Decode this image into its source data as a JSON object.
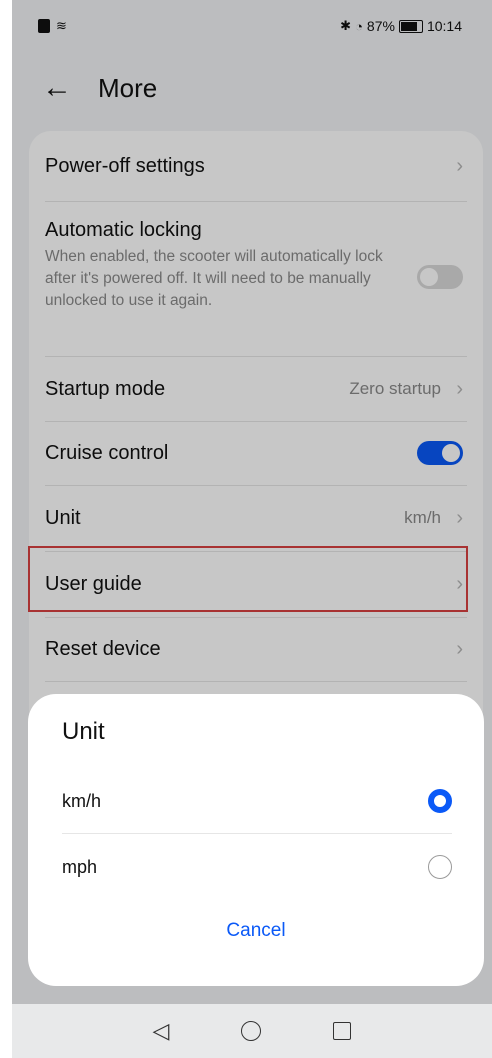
{
  "status_bar": {
    "battery_percent": "87%",
    "time": "10:14",
    "icons": [
      "sim-icon",
      "wifi-icon",
      "bluetooth-icon",
      "speed-icon",
      "battery-icon"
    ]
  },
  "header": {
    "back_icon": "back-arrow-icon",
    "title": "More"
  },
  "settings": {
    "power_off": {
      "label": "Power-off settings"
    },
    "auto_lock": {
      "label": "Automatic locking",
      "description": "When enabled, the scooter will automatically lock after it's powered off. It will need to be manually unlocked to use it again.",
      "enabled": false
    },
    "startup_mode": {
      "label": "Startup mode",
      "value": "Zero startup"
    },
    "cruise_control": {
      "label": "Cruise control",
      "enabled": true
    },
    "unit": {
      "label": "Unit",
      "value": "km/h"
    },
    "user_guide": {
      "label": "User guide"
    },
    "reset_device": {
      "label": "Reset device"
    }
  },
  "unit_sheet": {
    "title": "Unit",
    "options": [
      {
        "label": "km/h",
        "selected": true
      },
      {
        "label": "mph",
        "selected": false
      }
    ],
    "cancel_label": "Cancel"
  },
  "colors": {
    "accent": "#0a59f7",
    "highlight_border": "#d84141"
  }
}
